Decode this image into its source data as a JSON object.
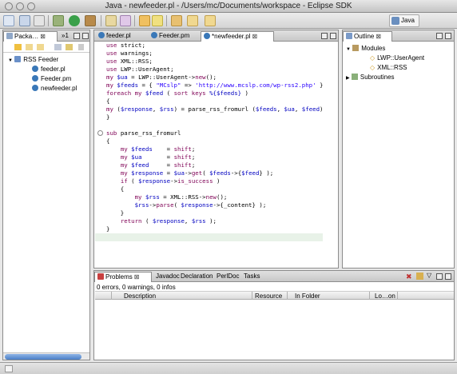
{
  "window": {
    "title": "Java - newfeeder.pl - /Users/mc/Documents/workspace - Eclipse SDK"
  },
  "toolbar": {
    "perspective_label": "Java"
  },
  "left_panel": {
    "tabs": [
      {
        "label": "Packa…",
        "close": "⊠"
      },
      {
        "label": "»1"
      }
    ],
    "tree": [
      {
        "label": "RSS Feeder",
        "icon": "folder-icon"
      },
      {
        "label": "feeder.pl",
        "icon": "perl-file-icon"
      },
      {
        "label": "Feeder.pm",
        "icon": "perl-file-icon"
      },
      {
        "label": "newfeeder.pl",
        "icon": "perl-file-icon"
      }
    ]
  },
  "editor": {
    "tabs": [
      {
        "label": "feeder.pl"
      },
      {
        "label": "Feeder.pm"
      },
      {
        "label": "*newfeeder.pl",
        "close": "⊠"
      }
    ],
    "lines": [
      [
        [
          "kw",
          "use "
        ],
        [
          "op",
          "strict;"
        ]
      ],
      [
        [
          "kw",
          "use "
        ],
        [
          "op",
          "warnings;"
        ]
      ],
      [
        [
          "kw",
          "use "
        ],
        [
          "op",
          "XML::RSS;"
        ]
      ],
      [
        [
          "kw",
          "use "
        ],
        [
          "op",
          "LWP::UserAgent;"
        ]
      ],
      [
        [
          "kw",
          "my "
        ],
        [
          "var",
          "$ua"
        ],
        [
          "op",
          " = LWP::UserAgent->"
        ],
        [
          "kw",
          "new"
        ],
        [
          "op",
          "();"
        ]
      ],
      [
        [
          "kw",
          "my "
        ],
        [
          "var",
          "$feeds"
        ],
        [
          "op",
          " = { "
        ],
        [
          "str",
          "\"MCslp\""
        ],
        [
          "op",
          " => "
        ],
        [
          "str",
          "'http://www.mcslp.com/wp-rss2.php'"
        ],
        [
          "op",
          " };"
        ]
      ],
      [
        [
          "kw",
          "foreach my "
        ],
        [
          "var",
          "$feed"
        ],
        [
          "op",
          " ( "
        ],
        [
          "kw",
          "sort keys "
        ],
        [
          "var",
          "%{$feeds}"
        ],
        [
          "op",
          " )"
        ]
      ],
      [
        [
          "op",
          "{"
        ]
      ],
      [
        [
          "kw",
          "my "
        ],
        [
          "op",
          "("
        ],
        [
          "var",
          "$response"
        ],
        [
          "op",
          ", "
        ],
        [
          "var",
          "$rss"
        ],
        [
          "op",
          ") = parse_rss_fromurl ("
        ],
        [
          "var",
          "$feeds"
        ],
        [
          "op",
          ", "
        ],
        [
          "var",
          "$ua"
        ],
        [
          "op",
          ", "
        ],
        [
          "var",
          "$feed"
        ],
        [
          "op",
          ");"
        ]
      ],
      [
        [
          "op",
          "}"
        ]
      ],
      [
        [
          "op",
          ""
        ]
      ],
      [
        [
          "kw",
          "sub "
        ],
        [
          "op",
          "parse_rss_fromurl"
        ]
      ],
      [
        [
          "op",
          "{"
        ]
      ],
      [
        [
          "op",
          "    "
        ],
        [
          "kw",
          "my "
        ],
        [
          "var",
          "$feeds"
        ],
        [
          "op",
          "    = "
        ],
        [
          "kw",
          "shift"
        ],
        [
          "op",
          ";"
        ]
      ],
      [
        [
          "op",
          "    "
        ],
        [
          "kw",
          "my "
        ],
        [
          "var",
          "$ua"
        ],
        [
          "op",
          "       = "
        ],
        [
          "kw",
          "shift"
        ],
        [
          "op",
          ";"
        ]
      ],
      [
        [
          "op",
          "    "
        ],
        [
          "kw",
          "my "
        ],
        [
          "var",
          "$feed"
        ],
        [
          "op",
          "     = "
        ],
        [
          "kw",
          "shift"
        ],
        [
          "op",
          ";"
        ]
      ],
      [
        [
          "op",
          "    "
        ],
        [
          "kw",
          "my "
        ],
        [
          "var",
          "$response"
        ],
        [
          "op",
          " = "
        ],
        [
          "var",
          "$ua"
        ],
        [
          "op",
          "->"
        ],
        [
          "kw",
          "get"
        ],
        [
          "op",
          "( "
        ],
        [
          "var",
          "$feeds"
        ],
        [
          "op",
          "->{"
        ],
        [
          "var",
          "$feed"
        ],
        [
          "op",
          "} );"
        ]
      ],
      [
        [
          "op",
          "    "
        ],
        [
          "kw",
          "if "
        ],
        [
          "op",
          "( "
        ],
        [
          "var",
          "$response"
        ],
        [
          "op",
          "->"
        ],
        [
          "kw",
          "is_success"
        ],
        [
          "op",
          " )"
        ]
      ],
      [
        [
          "op",
          "    {"
        ]
      ],
      [
        [
          "op",
          "        "
        ],
        [
          "kw",
          "my "
        ],
        [
          "var",
          "$rss"
        ],
        [
          "op",
          " = XML::RSS->"
        ],
        [
          "kw",
          "new"
        ],
        [
          "op",
          "();"
        ]
      ],
      [
        [
          "op",
          "        "
        ],
        [
          "var",
          "$rss"
        ],
        [
          "op",
          "->"
        ],
        [
          "kw",
          "parse"
        ],
        [
          "op",
          "( "
        ],
        [
          "var",
          "$response"
        ],
        [
          "op",
          "->{_content} );"
        ]
      ],
      [
        [
          "op",
          "    }"
        ]
      ],
      [
        [
          "op",
          "    "
        ],
        [
          "kw",
          "return "
        ],
        [
          "op",
          "( "
        ],
        [
          "var",
          "$response"
        ],
        [
          "op",
          ", "
        ],
        [
          "var",
          "$rss"
        ],
        [
          "op",
          " );"
        ]
      ],
      [
        [
          "op",
          "}"
        ]
      ],
      [
        [
          "op",
          ""
        ]
      ]
    ]
  },
  "outline": {
    "tab_label": "Outline",
    "close": "⊠",
    "items": [
      {
        "label": "Modules",
        "level": 0
      },
      {
        "label": "LWP::UserAgent",
        "level": 1
      },
      {
        "label": "XML::RSS",
        "level": 1
      },
      {
        "label": "Subroutines",
        "level": 0
      }
    ]
  },
  "bottom_panel": {
    "tabs": [
      {
        "label": "Problems",
        "close": "⊠"
      },
      {
        "label": "Javadoc"
      },
      {
        "label": "Declaration"
      },
      {
        "label": "PerlDoc"
      },
      {
        "label": "Tasks"
      }
    ],
    "summary": "0 errors, 0 warnings, 0 infos",
    "columns": [
      "Description",
      "Resource",
      "In Folder",
      "Lo…on"
    ]
  },
  "colors": {
    "keyword": "#7f0055",
    "variable": "#0000c0",
    "string": "#2a00ff",
    "accent": "#4a7fc7"
  }
}
